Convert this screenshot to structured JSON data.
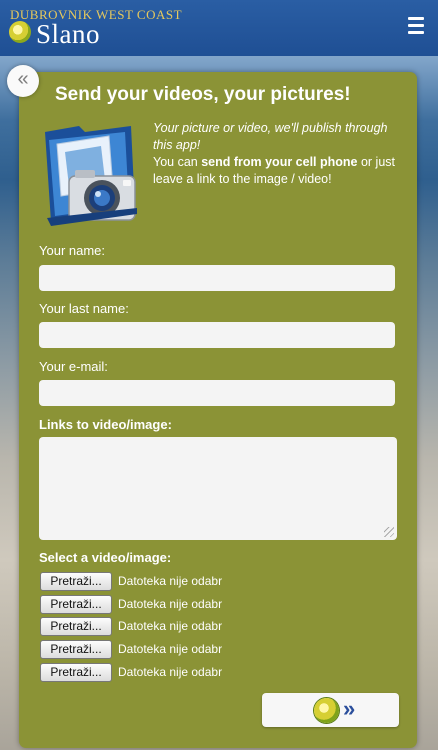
{
  "header": {
    "brand_line1": "DUBROVNIK WEST COAST",
    "brand_line2": "Slano",
    "logo_icon": "dandelion-logo-icon",
    "menu_icon": "hamburger-menu-icon"
  },
  "colors": {
    "header_bg": "#1f4f94",
    "panel_bg": "#8b9336",
    "brand_gold": "#e7c95c"
  },
  "panel": {
    "title": "Send your videos, your pictures!",
    "intro_italic": "Your picture or video, we'll publish through this app!",
    "intro_part1": "You can ",
    "intro_bold": "send from your cell phone",
    "intro_part2": " or just leave a link to the image / video!",
    "intro_image_icon": "camera-folder-icon"
  },
  "form": {
    "name_label": "Your name:",
    "name_value": "",
    "last_name_label": "Your last name:",
    "last_name_value": "",
    "email_label": "Your e-mail:",
    "email_value": "",
    "links_label": "Links to video/image:",
    "links_value": "",
    "select_label": "Select a video/image:",
    "files": [
      {
        "button": "Pretraži...",
        "status": "Datoteka nije odabr"
      },
      {
        "button": "Pretraži...",
        "status": "Datoteka nije odabr"
      },
      {
        "button": "Pretraži...",
        "status": "Datoteka nije odabr"
      },
      {
        "button": "Pretraži...",
        "status": "Datoteka nije odabr"
      },
      {
        "button": "Pretraži...",
        "status": "Datoteka nije odabr"
      }
    ],
    "submit_arrows": "»"
  },
  "nav": {
    "back_glyph": "«"
  }
}
